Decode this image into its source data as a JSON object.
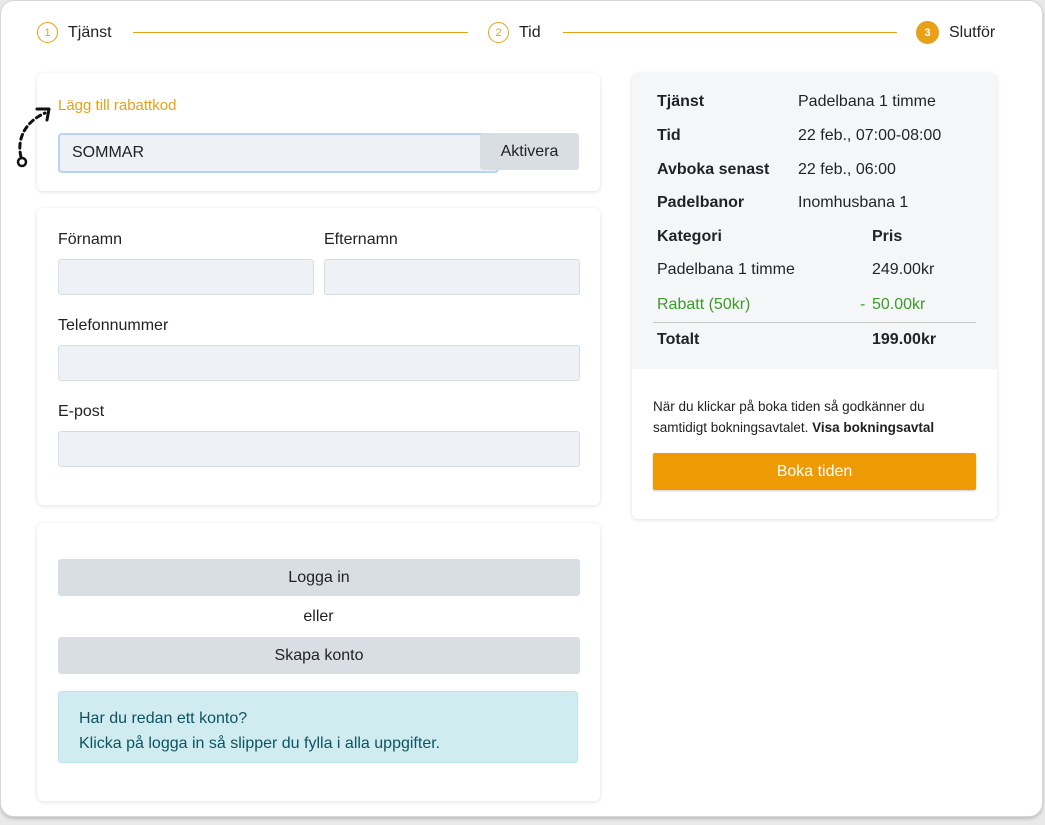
{
  "stepper": {
    "steps": [
      {
        "number": "1",
        "label": "Tjänst"
      },
      {
        "number": "2",
        "label": "Tid"
      },
      {
        "number": "3",
        "label": "Slutför"
      }
    ]
  },
  "discount": {
    "link_label": "Lägg till rabattkod",
    "code_value": "SOMMAR",
    "activate_label": "Aktivera"
  },
  "form": {
    "first_name_label": "Förnamn",
    "last_name_label": "Efternamn",
    "phone_label": "Telefonnummer",
    "email_label": "E-post"
  },
  "account": {
    "login_label": "Logga in",
    "or_label": "eller",
    "create_label": "Skapa konto",
    "info_line1": "Har du redan ett konto?",
    "info_line2": "Klicka på logga in så slipper du fylla i alla uppgifter."
  },
  "summary": {
    "rows": [
      {
        "key": "Tjänst",
        "value": "Padelbana 1 timme"
      },
      {
        "key": "Tid",
        "value": "22 feb., 07:00-08:00"
      },
      {
        "key": "Avboka senast",
        "value": "22 feb., 06:00"
      },
      {
        "key": "Padelbanor",
        "value": "Inomhusbana 1"
      }
    ],
    "category_header": "Kategori",
    "price_header": "Pris",
    "item_name": "Padelbana 1 timme",
    "item_price": "249.00kr",
    "discount_name": "Rabatt (50kr)",
    "discount_sign": "-",
    "discount_price": "50.00kr",
    "total_label": "Totalt",
    "total_price": "199.00kr",
    "terms_text": "När du klickar på boka tiden så godkänner du samtidigt bokningsavtalet.",
    "terms_link": "Visa bokningsavtal",
    "book_label": "Boka tiden"
  },
  "colors": {
    "accent": "#e8a019",
    "book_button": "#ed9a05",
    "discount_green": "#3e9a2a",
    "info_bg": "#d1ecf1"
  }
}
